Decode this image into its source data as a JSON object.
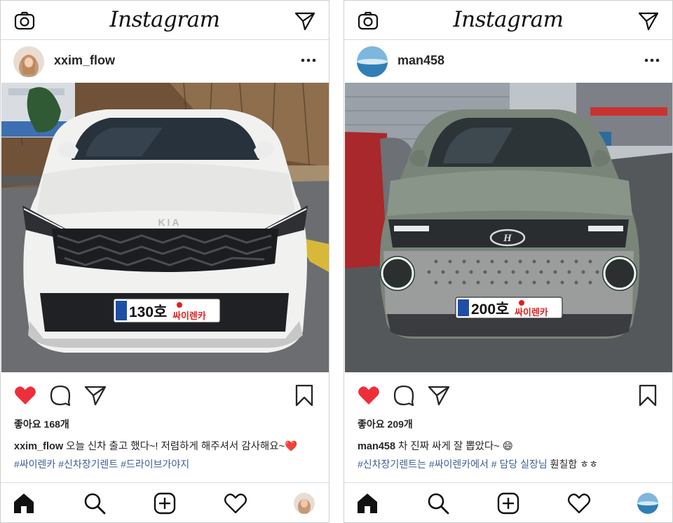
{
  "app": {
    "wordmark": "Instagram"
  },
  "posts": [
    {
      "username": "xxim_flow",
      "likes_text": "좋아요 168개",
      "caption_user": "xxim_flow",
      "caption_text": " 오늘 신차 출고 했다~! 저렴하게 해주셔서 감사해요~",
      "caption_emoji": "❤️",
      "hashtags": "#싸이렌카 #신차장기렌트 #드라이브가야지",
      "hashtags_extra": "",
      "plate": {
        "number": "130호",
        "brand": "싸이렌카"
      },
      "car_brand": "KIA",
      "car_color": "white",
      "avatar_icon": "person-photo",
      "heart_color": "#ed2f3b"
    },
    {
      "username": "man458",
      "likes_text": "좋아요 209개",
      "caption_user": "man458",
      "caption_text": " 차 진짜 싸게 잘 뽑았다~ ",
      "caption_emoji": "😄",
      "hashtags": "#신차장기렌트는 #싸이렌카에서 # 담당 실장님",
      "hashtags_extra": " 훤칠함 ㅎㅎ",
      "plate": {
        "number": "200호",
        "brand": "싸이렌카"
      },
      "car_brand": "HYUNDAI",
      "car_color": "sage-green",
      "avatar_icon": "ocean-photo",
      "heart_color": "#ed2f3b"
    }
  ],
  "icons": [
    "camera-icon",
    "send-icon",
    "more-icon",
    "heart-icon",
    "comment-icon",
    "share-icon",
    "bookmark-icon",
    "home-icon",
    "search-icon",
    "add-post-icon",
    "activity-icon",
    "profile-avatar"
  ]
}
